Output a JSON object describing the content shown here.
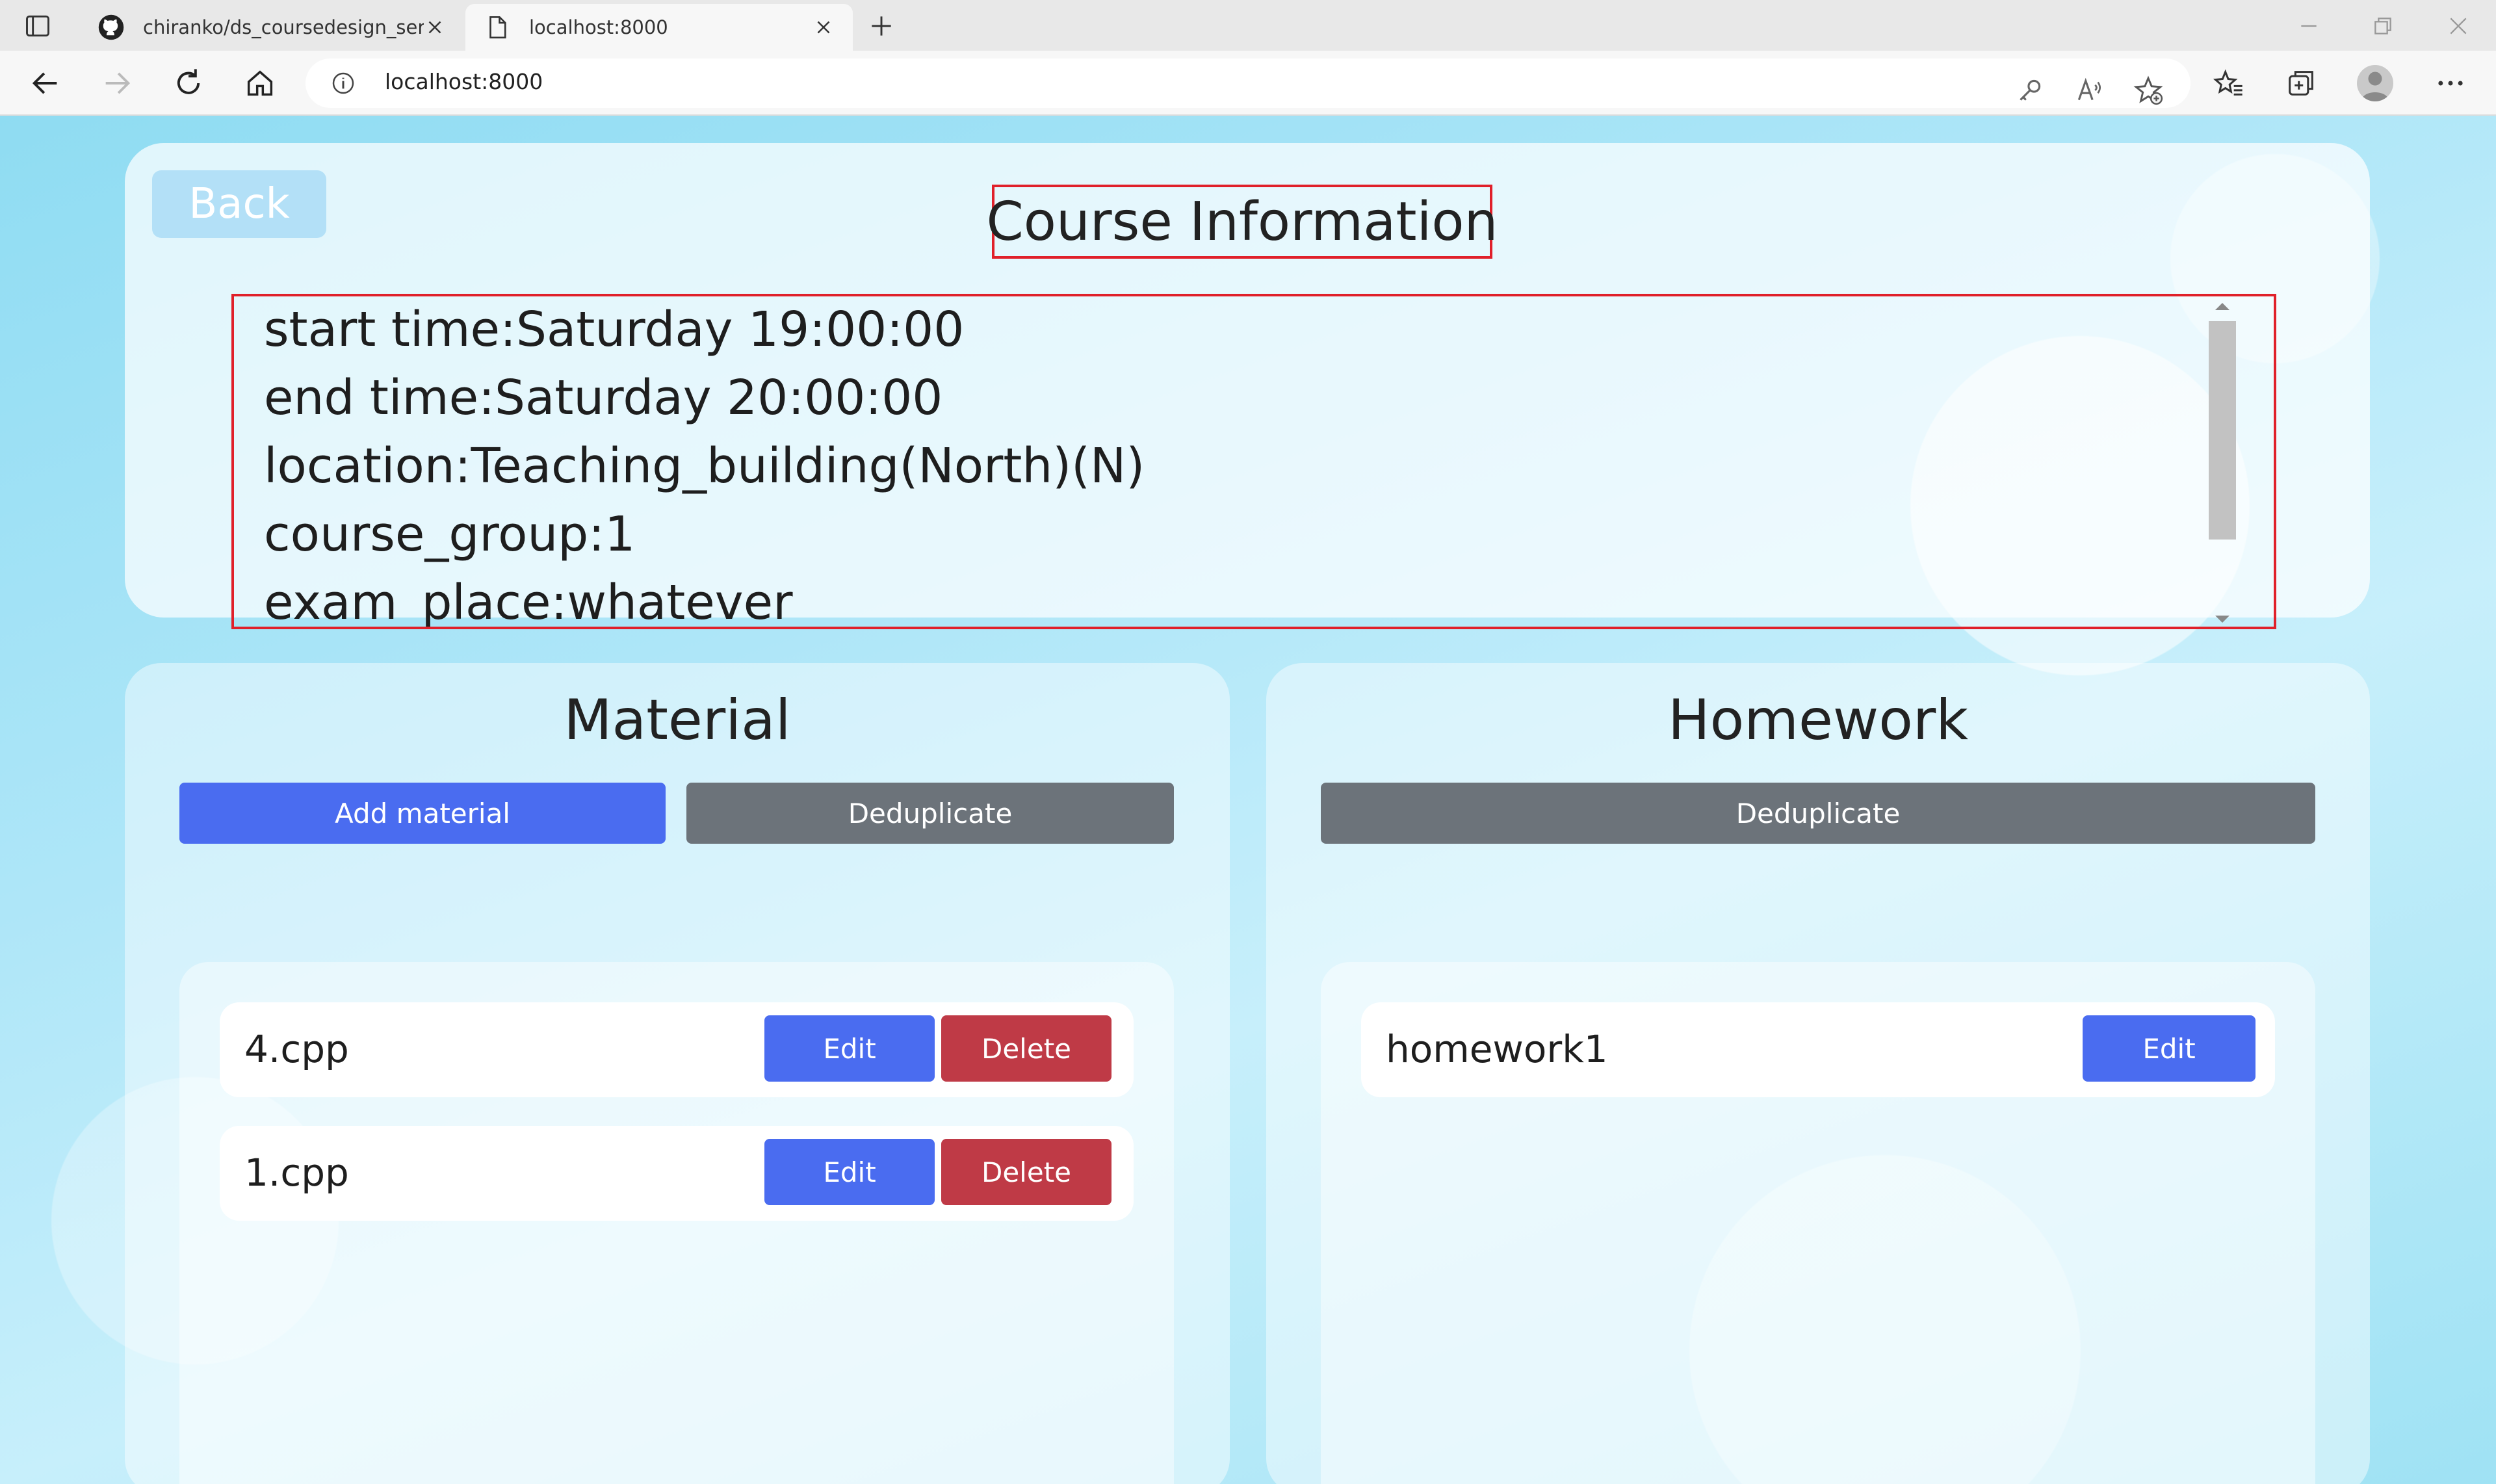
{
  "browser": {
    "tabs": [
      {
        "title": "chiranko/ds_coursedesign_server",
        "active": false
      },
      {
        "title": "localhost:8000",
        "active": true
      }
    ],
    "url": "localhost:8000"
  },
  "page": {
    "back_label": "Back",
    "course_title": "Course Information",
    "info_lines": [
      "start time:Saturday 19:00:00",
      "end time:Saturday 20:00:00",
      "location:Teaching_building(North)(N)",
      "course_group:1",
      "exam_place:whatever"
    ],
    "material": {
      "title": "Material",
      "add_label": "Add material",
      "dedup_label": "Deduplicate",
      "items": [
        {
          "name": "4.cpp",
          "edit": "Edit",
          "delete": "Delete"
        },
        {
          "name": "1.cpp",
          "edit": "Edit",
          "delete": "Delete"
        }
      ]
    },
    "homework": {
      "title": "Homework",
      "dedup_label": "Deduplicate",
      "items": [
        {
          "name": "homework1",
          "edit": "Edit"
        }
      ]
    }
  },
  "colors": {
    "primary": "#4a6cf0",
    "secondary": "#6c737a",
    "danger": "#bf3a46",
    "highlight_border": "#e0202a"
  }
}
